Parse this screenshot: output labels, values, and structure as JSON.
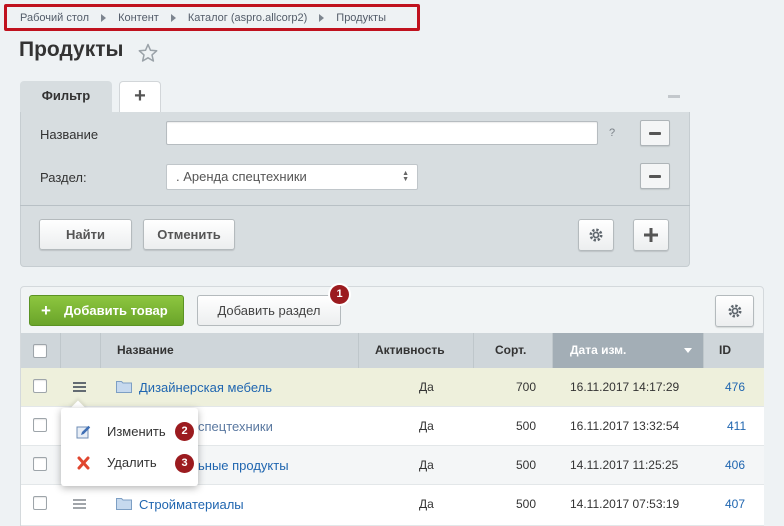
{
  "breadcrumb": {
    "items": [
      "Рабочий стол",
      "Контент",
      "Каталог (aspro.allcorp2)",
      "Продукты"
    ],
    "highlight_color": "#c0121e"
  },
  "page": {
    "title": "Продукты"
  },
  "filter": {
    "tab_label": "Фильтр",
    "add_tab_label": "+",
    "fields": [
      {
        "label": "Название",
        "value": "",
        "help": "?"
      },
      {
        "label": "Раздел:",
        "value": ". Аренда спецтехники"
      }
    ],
    "find_label": "Найти",
    "cancel_label": "Отменить"
  },
  "toolbar": {
    "add_product_label": "Добавить товар",
    "add_section_label": "Добавить раздел",
    "add_product_color": "#7ab533"
  },
  "badges": [
    "1",
    "2",
    "3"
  ],
  "table": {
    "columns": [
      "Название",
      "Активность",
      "Сорт.",
      "Дата изм.",
      "ID"
    ],
    "sorted_column": "Дата изм.",
    "rows": [
      {
        "name": "Дизайнерская мебель",
        "active": "Да",
        "sort": "700",
        "date": "16.11.2017 14:17:29",
        "id": "476"
      },
      {
        "name": "Аренда спецтехники",
        "name_visible": "спецтехники",
        "active": "Да",
        "sort": "500",
        "date": "16.11.2017 13:32:54",
        "id": "411"
      },
      {
        "name": "Напольные продукты",
        "name_visible": "ьные продукты",
        "active": "Да",
        "sort": "500",
        "date": "14.11.2017 11:25:25",
        "id": "406"
      },
      {
        "name": "Стройматериалы",
        "active": "Да",
        "sort": "500",
        "date": "14.11.2017 07:53:19",
        "id": "407"
      }
    ]
  },
  "context_menu": {
    "items": [
      {
        "label": "Изменить",
        "icon": "edit-icon"
      },
      {
        "label": "Удалить",
        "icon": "delete-icon"
      }
    ]
  }
}
